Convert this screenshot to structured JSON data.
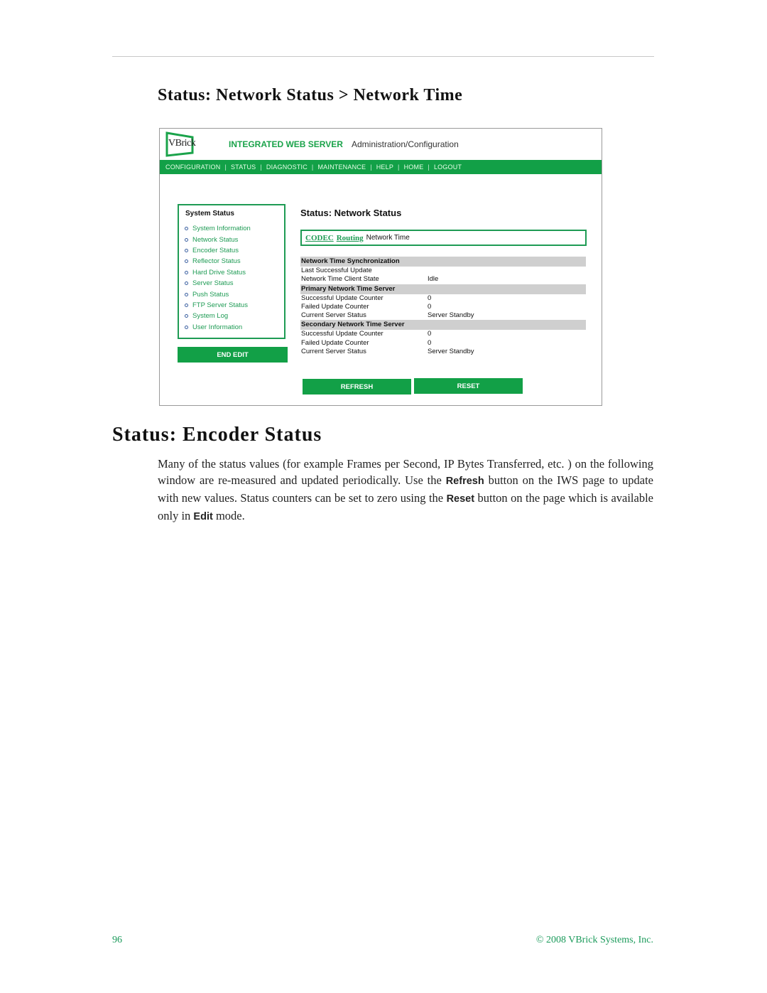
{
  "document": {
    "subsection_title": "Status: Network Status > Network Time",
    "section_title": "Status: Encoder Status",
    "paragraph": {
      "part1": "Many of the status values (for example Frames per Second, IP Bytes Transferred, etc. ) on the following window are re-measured and updated periodically. Use the ",
      "bold1": "Refresh",
      "part2": " button on the IWS page to update with new values. Status counters can be set to zero using the ",
      "bold2": "Reset",
      "part3": " button on the page which is available only in ",
      "bold3": "Edit",
      "part4": " mode."
    },
    "footer": {
      "page_number": "96",
      "copyright": "© 2008 VBrick Systems, Inc."
    }
  },
  "screenshot": {
    "logo_text": "VBrick",
    "app_title": "INTEGRATED WEB SERVER",
    "app_subtitle": "Administration/Configuration",
    "nav": [
      "CONFIGURATION",
      "STATUS",
      "DIAGNOSTIC",
      "MAINTENANCE",
      "HELP",
      "HOME",
      "LOGOUT"
    ],
    "sidebar": {
      "title": "System Status",
      "items": [
        "System Information",
        "Network Status",
        "Encoder Status",
        "Reflector Status",
        "Hard Drive Status",
        "Server Status",
        "Push Status",
        "FTP Server Status",
        "System Log",
        "User Information"
      ],
      "end_edit": "END EDIT"
    },
    "content_title": "Status: Network Status",
    "tabs": {
      "codec": "CODEC",
      "routing": "Routing",
      "current": "Network Time"
    },
    "sections": [
      {
        "title": "Network Time Synchronization",
        "rows": [
          {
            "label": "Last Successful Update",
            "value": ""
          },
          {
            "label": "Network Time Client State",
            "value": "Idle"
          }
        ]
      },
      {
        "title": "Primary Network Time Server",
        "rows": [
          {
            "label": "Successful Update Counter",
            "value": "0"
          },
          {
            "label": "Failed Update Counter",
            "value": "0"
          },
          {
            "label": "Current Server Status",
            "value": "Server Standby"
          }
        ]
      },
      {
        "title": "Secondary Network Time Server",
        "rows": [
          {
            "label": "Successful Update Counter",
            "value": "0"
          },
          {
            "label": "Failed Update Counter",
            "value": "0"
          },
          {
            "label": "Current Server Status",
            "value": "Server Standby"
          }
        ]
      }
    ],
    "buttons": {
      "refresh": "REFRESH",
      "reset": "RESET"
    }
  },
  "colors": {
    "brand_green": "#12a047",
    "link_green": "#1e9b54",
    "section_gray": "#cfcfcf",
    "footer_green": "#1a9a5a"
  }
}
